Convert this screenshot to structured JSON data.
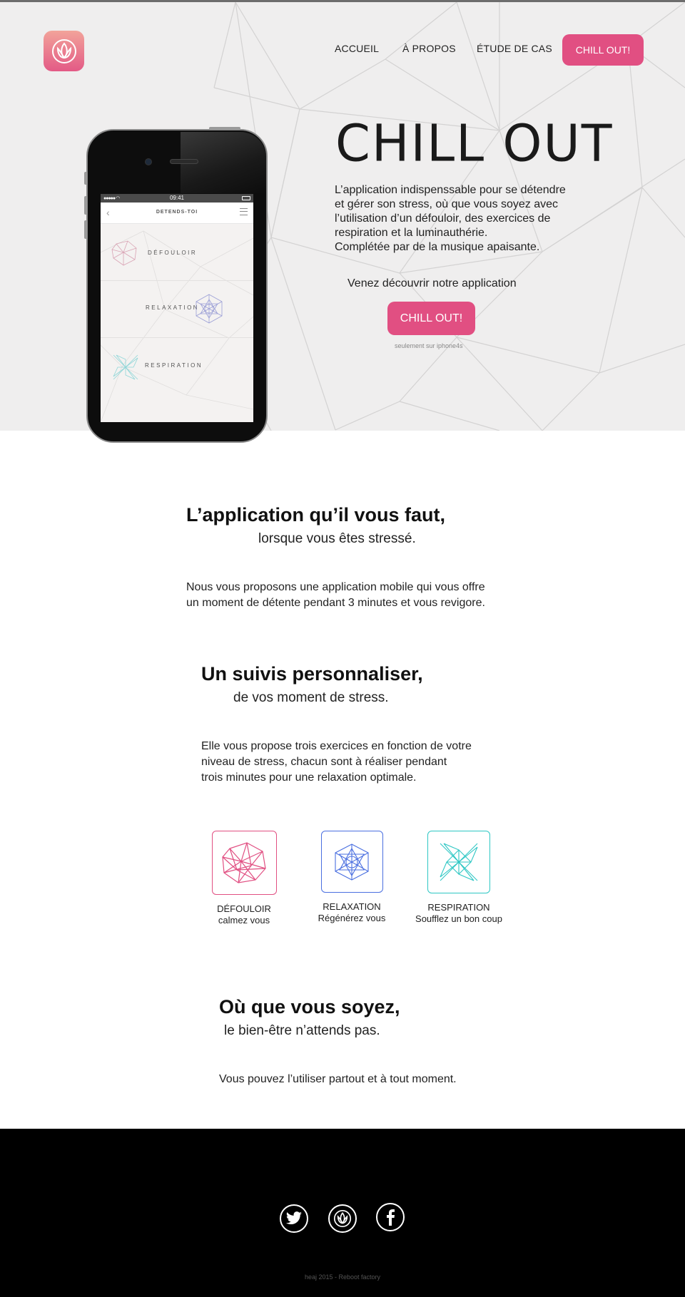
{
  "nav": {
    "items": [
      "ACCUEIL",
      "À PROPOS",
      "ÉTUDE DE CAS"
    ],
    "cta": "CHILL OUT!"
  },
  "hero": {
    "title": "CHILL OUT",
    "description": [
      "L’application indispenssable pour se détendre",
      "et gérer son stress, où que vous soyez avec",
      "l’utilisation d’un défouloir, des exercices de",
      "respiration et la luminauthérie.",
      "Complétée par de la musique apaisante."
    ],
    "discover": "Venez découvrir notre application",
    "cta": "CHILL OUT!",
    "note": "seulement sur iphone4s"
  },
  "phone": {
    "time": "09:41",
    "screen_title": "DETENDS-TOI",
    "rows": [
      "DÉFOULOIR",
      "RELAXATION",
      "RESPIRATION"
    ]
  },
  "section1": {
    "title": "L’application qu’il vous faut,",
    "subtitle": "lorsque vous êtes stressé.",
    "text": [
      "Nous vous proposons une application mobile qui vous offre",
      "un moment de détente pendant 3 minutes et vous revigore."
    ]
  },
  "section2": {
    "title": "Un suivis personnaliser,",
    "subtitle": "de vos moment de stress.",
    "text": [
      "Elle vous propose trois exercices en fonction de votre",
      "niveau de stress, chacun sont à réaliser pendant",
      "trois minutes pour une relaxation optimale."
    ]
  },
  "exercises": [
    {
      "name": "DÉFOULOIR",
      "sub": "calmez vous",
      "color": "#e14f82",
      "icon": "polyhedron-icon"
    },
    {
      "name": "RELAXATION",
      "sub": "Régénérez vous",
      "color": "#4a6fe0",
      "icon": "mandala-icon"
    },
    {
      "name": "RESPIRATION",
      "sub": "Soufflez un bon coup",
      "color": "#2ec7c4",
      "icon": "pinwheel-icon"
    }
  ],
  "section3": {
    "title": "Où que vous soyez,",
    "subtitle": "le bien-être n’attends pas.",
    "text": [
      "Vous pouvez l’utiliser partout et à tout moment."
    ]
  },
  "footer": {
    "social": [
      "twitter-icon",
      "lotus-icon",
      "facebook-icon"
    ],
    "copyright": "heaj 2015 - Reboot factory"
  },
  "colors": {
    "accent": "#e14f82",
    "hero_bg": "#efeeee",
    "footer_bg": "#000000"
  }
}
